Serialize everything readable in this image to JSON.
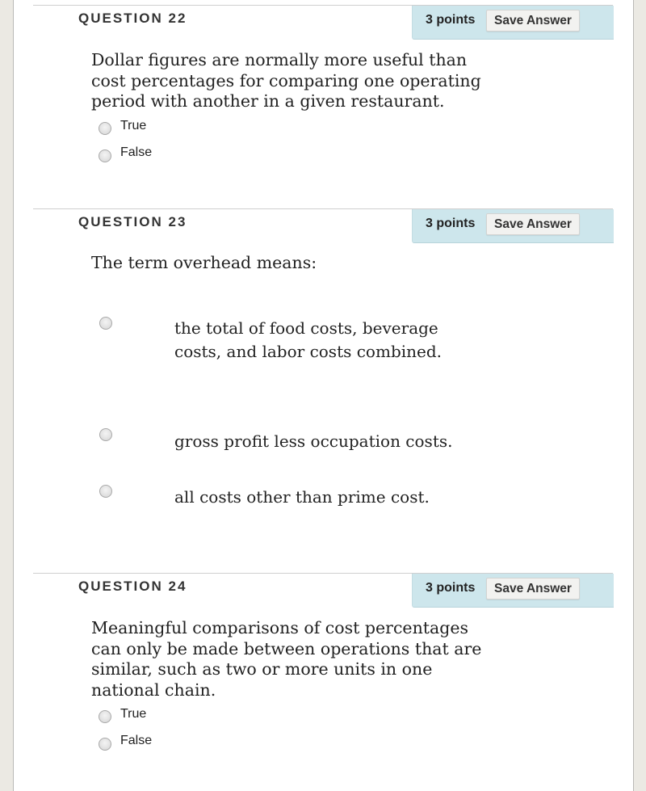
{
  "questions": [
    {
      "title": "QUESTION 22",
      "points": "3 points",
      "save_label": "Save Answer",
      "text": "Dollar figures are normally more useful than cost percentages for comparing one operating period with another in a given restaurant.",
      "options": [
        "True",
        "False"
      ]
    },
    {
      "title": "QUESTION 23",
      "points": "3 points",
      "save_label": "Save Answer",
      "text": "The term overhead means:",
      "options": [
        "the total of food costs, beverage costs, and labor costs combined.",
        "gross profit less occupation costs.",
        "all costs other than prime cost."
      ]
    },
    {
      "title": "QUESTION 24",
      "points": "3 points",
      "save_label": "Save Answer",
      "text": "Meaningful comparisons of cost percentages can only be made between operations that are similar, such as two or more units in one national chain.",
      "options": [
        "True",
        "False"
      ]
    }
  ],
  "colors": {
    "points_box": "#cde6ec",
    "page_background": "#ebe9e3"
  }
}
